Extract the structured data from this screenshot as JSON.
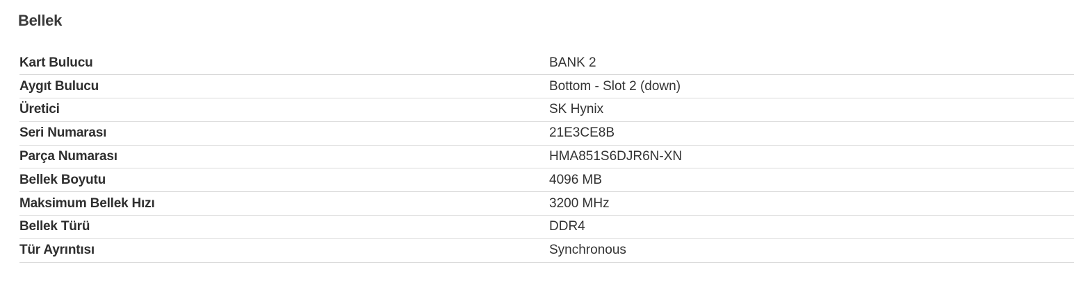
{
  "section": {
    "title": "Bellek"
  },
  "rows": [
    {
      "label": "Kart Bulucu",
      "value": "BANK 2"
    },
    {
      "label": "Aygıt Bulucu",
      "value": "Bottom - Slot 2 (down)"
    },
    {
      "label": "Üretici",
      "value": "SK Hynix"
    },
    {
      "label": "Seri Numarası",
      "value": "21E3CE8B"
    },
    {
      "label": "Parça Numarası",
      "value": "HMA851S6DJR6N-XN"
    },
    {
      "label": "Bellek Boyutu",
      "value": "4096 MB"
    },
    {
      "label": "Maksimum Bellek Hızı",
      "value": "3200 MHz"
    },
    {
      "label": "Bellek Türü",
      "value": "DDR4"
    },
    {
      "label": "Tür Ayrıntısı",
      "value": "Synchronous"
    }
  ],
  "colors": {
    "text": "#2b2b2b",
    "divider": "#d9d9d9",
    "background": "#ffffff"
  }
}
